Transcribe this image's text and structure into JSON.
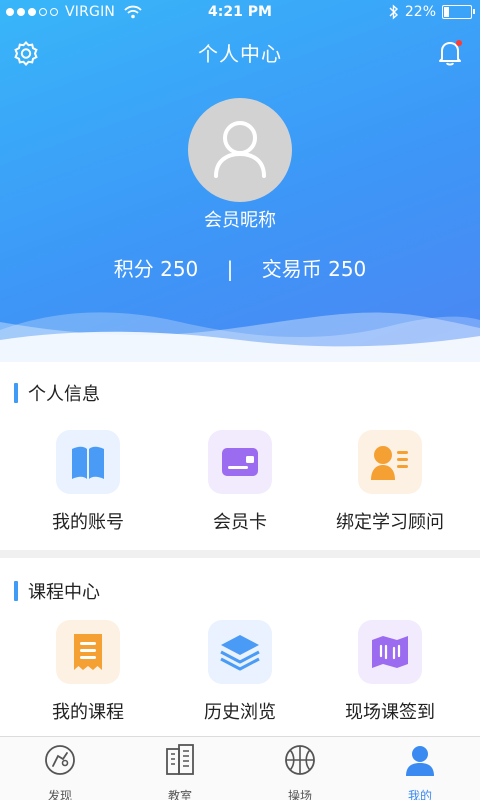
{
  "status_bar": {
    "carrier": "VIRGIN",
    "time": "4:21 PM",
    "battery": "22%",
    "battery_level": 0.22
  },
  "header": {
    "title": "个人中心"
  },
  "profile": {
    "nickname": "会员昵称",
    "points_label": "积分 250",
    "separator": "|",
    "coins_label": "交易币 250"
  },
  "sections": [
    {
      "title": "个人信息",
      "items": [
        {
          "label": "我的账号",
          "icon": "book-icon",
          "tile_color": "#e9f2fe",
          "icon_color": "#4a9bf6"
        },
        {
          "label": "会员卡",
          "icon": "card-icon",
          "tile_color": "#f1ebfd",
          "icon_color": "#9b6cf0"
        },
        {
          "label": "绑定学习顾问",
          "icon": "advisor-icon",
          "tile_color": "#fdf1e4",
          "icon_color": "#f5a033"
        }
      ]
    },
    {
      "title": "课程中心",
      "items": [
        {
          "label": "我的课程",
          "icon": "receipt-icon",
          "tile_color": "#fdf1e4",
          "icon_color": "#f5a033"
        },
        {
          "label": "历史浏览",
          "icon": "layers-icon",
          "tile_color": "#e9f2fe",
          "icon_color": "#4a9bf6"
        },
        {
          "label": "现场课签到",
          "icon": "map-icon",
          "tile_color": "#f1ebfd",
          "icon_color": "#9b6cf0"
        }
      ]
    }
  ],
  "tabbar": {
    "tabs": [
      {
        "label": "发现",
        "icon": "discover-icon",
        "active": false
      },
      {
        "label": "教室",
        "icon": "building-icon",
        "active": false
      },
      {
        "label": "操场",
        "icon": "basketball-icon",
        "active": false
      },
      {
        "label": "我的",
        "icon": "user-icon",
        "active": true
      }
    ]
  },
  "colors": {
    "accent": "#3b8af2",
    "header_gradient_start": "#38b6f9",
    "header_gradient_end": "#4c86f3",
    "notification_dot": "#ff3b30"
  }
}
